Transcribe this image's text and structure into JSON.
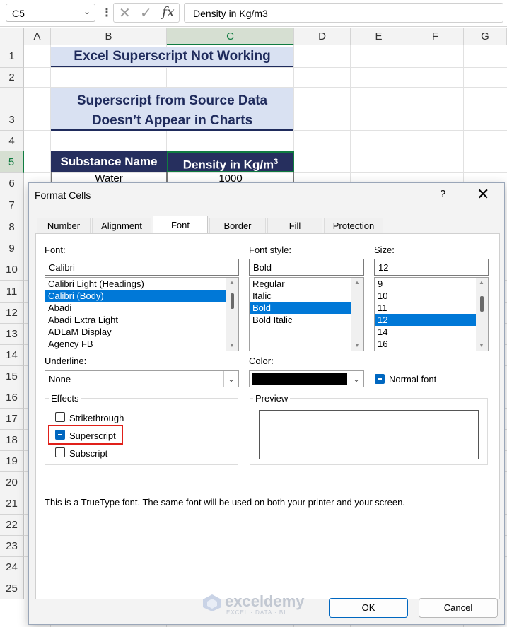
{
  "formula_bar": {
    "name_box": "C5",
    "formula": "Density in Kg/m3"
  },
  "columns": [
    "A",
    "B",
    "C",
    "D",
    "E",
    "F",
    "G"
  ],
  "rows": [
    "1",
    "2",
    "3",
    "4",
    "5",
    "6",
    "7",
    "8",
    "9",
    "10",
    "11",
    "12",
    "13",
    "14",
    "15",
    "16",
    "17",
    "18",
    "19",
    "20",
    "21",
    "22",
    "23",
    "24",
    "25"
  ],
  "selected_cell": {
    "column": "C",
    "row": "5"
  },
  "sheet": {
    "title": "Excel Superscript Not Working",
    "subtitle_line1": "Superscript from Source Data",
    "subtitle_line2": "Doesn’t Appear in Charts",
    "header_substance": "Substance Name",
    "header_density": "Density in Kg/m",
    "header_density_sup": "3",
    "row6_b": "Water",
    "row6_c": "1000"
  },
  "dialog": {
    "title": "Format Cells",
    "help": "?",
    "close": "✕",
    "tabs": [
      "Number",
      "Alignment",
      "Font",
      "Border",
      "Fill",
      "Protection"
    ],
    "active_tab": "Font",
    "font_label": "Font:",
    "font_value": "Calibri",
    "font_list": [
      "Calibri Light (Headings)",
      "Calibri (Body)",
      "Abadi",
      "Abadi Extra Light",
      "ADLaM Display",
      "Agency FB"
    ],
    "font_selected": "Calibri (Body)",
    "style_label": "Font style:",
    "style_value": "Bold",
    "style_list": [
      "Regular",
      "Italic",
      "Bold",
      "Bold Italic"
    ],
    "style_selected": "Bold",
    "size_label": "Size:",
    "size_value": "12",
    "size_list": [
      "9",
      "10",
      "11",
      "12",
      "14",
      "16"
    ],
    "size_selected": "12",
    "underline_label": "Underline:",
    "underline_value": "None",
    "color_label": "Color:",
    "color_value": "#000000",
    "normal_font_label": "Normal font",
    "normal_font_checked": true,
    "effects_label": "Effects",
    "strikethrough_label": "Strikethrough",
    "strikethrough_checked": false,
    "superscript_label": "Superscript",
    "superscript_checked": true,
    "subscript_label": "Subscript",
    "subscript_checked": false,
    "preview_label": "Preview",
    "info_text": "This is a TrueType font.  The same font will be used on both your printer and your screen.",
    "ok": "OK",
    "cancel": "Cancel"
  },
  "watermark": {
    "name": "exceldemy",
    "tagline": "EXCEL · DATA · BI"
  },
  "colors": {
    "excel_green": "#107c41",
    "header_navy": "#262f5e",
    "title_fill": "#d9e1f2",
    "selection_blue": "#0078d7",
    "highlight_red": "#e0201a"
  }
}
